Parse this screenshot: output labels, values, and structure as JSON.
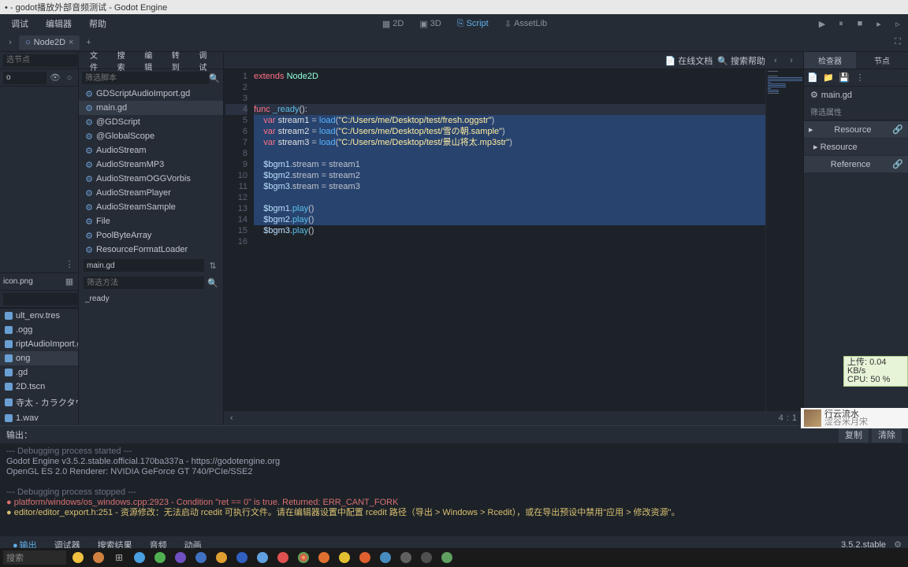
{
  "window": {
    "title": "• - godot播放外部音频测试 - Godot Engine"
  },
  "menu": {
    "debug": "调试",
    "editor": "编辑器",
    "help": "帮助"
  },
  "modes": {
    "d2": "2D",
    "d3": "3D",
    "script": "Script",
    "assetlib": "AssetLib"
  },
  "scene_tree": {
    "tab": "Node2D",
    "search_placeholder": "选节点",
    "node_root": "o"
  },
  "filesystem": {
    "file_preview": "icon.png",
    "items": [
      "ult_env.tres",
      ".ogg",
      "riptAudioImport.gd",
      "ong",
      ".gd",
      "2D.tscn",
      "寺太 - カラクタウン.",
      "1.wav"
    ],
    "selected_index": 3
  },
  "script_panel": {
    "filter_placeholder": "筛选脚本",
    "items": [
      "GDScriptAudioImport.gd",
      "main.gd",
      "@GDScript",
      "@GlobalScope",
      "AudioStream",
      "AudioStreamMP3",
      "AudioStreamOGGVorbis",
      "AudioStreamPlayer",
      "AudioStreamSample",
      "File",
      "PoolByteArray",
      "ResourceFormatLoader"
    ],
    "active_index": 1,
    "current_script": "main.gd",
    "method_filter_placeholder": "筛选方法",
    "method": "_ready"
  },
  "editor": {
    "menu": {
      "file": "文件",
      "search": "搜索",
      "edit": "编辑",
      "goto": "转到",
      "debug": "调试"
    },
    "right": {
      "online_docs": "在线文档",
      "search_help": "搜索帮助"
    },
    "status": {
      "line": "4",
      "col": "1"
    },
    "lines": [
      {
        "n": 1,
        "html": "<span class='kw'>extends</span> <span class='type'>Node2D</span>"
      },
      {
        "n": 2,
        "html": ""
      },
      {
        "n": 3,
        "html": ""
      },
      {
        "n": 4,
        "html": "<span class='kw'>func</span> <span class='fn'>_ready</span>():",
        "hl": true
      },
      {
        "n": 5,
        "html": "    <span class='kw'>var</span> <span class='var'>stream1</span> = <span class='builtin'>load</span>(<span class='str'>\"C:/Users/me/Desktop/test/fresh.oggstr\"</span>)",
        "sel": true
      },
      {
        "n": 6,
        "html": "    <span class='kw'>var</span> <span class='var'>stream2</span> = <span class='builtin'>load</span>(<span class='str'>\"C:/Users/me/Desktop/test/雪の朝.sample\"</span>)",
        "sel": true
      },
      {
        "n": 7,
        "html": "    <span class='kw'>var</span> <span class='var'>stream3</span> = <span class='builtin'>load</span>(<span class='str'>\"C:/Users/me/Desktop/test/景山将太.mp3str\"</span>)",
        "sel": true
      },
      {
        "n": 8,
        "html": "    ",
        "sel": true
      },
      {
        "n": 9,
        "html": "    <span class='member'>$bgm1</span>.stream = stream1",
        "sel": true
      },
      {
        "n": 10,
        "html": "    <span class='member'>$bgm2</span>.stream = stream2",
        "sel": true
      },
      {
        "n": 11,
        "html": "    <span class='member'>$bgm3</span>.stream = stream3",
        "sel": true
      },
      {
        "n": 12,
        "html": "    ",
        "sel": true
      },
      {
        "n": 13,
        "html": "    <span class='member'>$bgm1</span>.<span class='fn'>play</span>()",
        "sel": true
      },
      {
        "n": 14,
        "html": "    <span class='member'>$bgm2</span>.<span class='fn'>play</span>()",
        "sel": true
      },
      {
        "n": 15,
        "html": "    <span class='member'>$bgm3</span>.<span class='fn'>play</span>()"
      },
      {
        "n": 16,
        "html": ""
      }
    ]
  },
  "inspector": {
    "tabs": {
      "inspector": "检查器",
      "node": "节点"
    },
    "file": "main.gd",
    "filter": "筛选属性",
    "sections": {
      "resource": "Resource",
      "resource_sub": "Resource",
      "reference": "Reference"
    }
  },
  "output": {
    "title": "输出：",
    "copy": "复制",
    "clear": "清除",
    "lines": [
      {
        "cls": "o-green",
        "t": "--- Debugging process started ---"
      },
      {
        "cls": "",
        "t": "Godot Engine v3.5.2.stable.official.170ba337a - https://godotengine.org"
      },
      {
        "cls": "",
        "t": "OpenGL ES 2.0 Renderer: NVIDIA GeForce GT 740/PCIe/SSE2"
      },
      {
        "cls": "",
        "t": " "
      },
      {
        "cls": "o-green",
        "t": "--- Debugging process stopped ---"
      },
      {
        "cls": "o-red",
        "t": "● platform/windows/os_windows.cpp:2923 - Condition \"ret == 0\" is true. Returned: ERR_CANT_FORK",
        "bullet": "r"
      },
      {
        "cls": "o-yellow",
        "t": "● editor/editor_export.h:251 - 资源修改：无法启动 rcedit 可执行文件。请在编辑器设置中配置 rcedit 路径（导出 > Windows > Rcedit），或在导出预设中禁用\"应用 > 修改资源\"。",
        "bullet": "y"
      }
    ],
    "tabs": {
      "output": "输出",
      "debugger": "调试器",
      "search_results": "搜索结果",
      "audio": "音频",
      "anim": "动画"
    },
    "version": "3.5.2.stable"
  },
  "perf": {
    "up": "上传: 0.04 KB/s",
    "cpu": "CPU: 50 %"
  },
  "music": {
    "title": "行云流水",
    "artist": "涩谷米月宋"
  },
  "taskbar": {
    "search": "搜索"
  }
}
